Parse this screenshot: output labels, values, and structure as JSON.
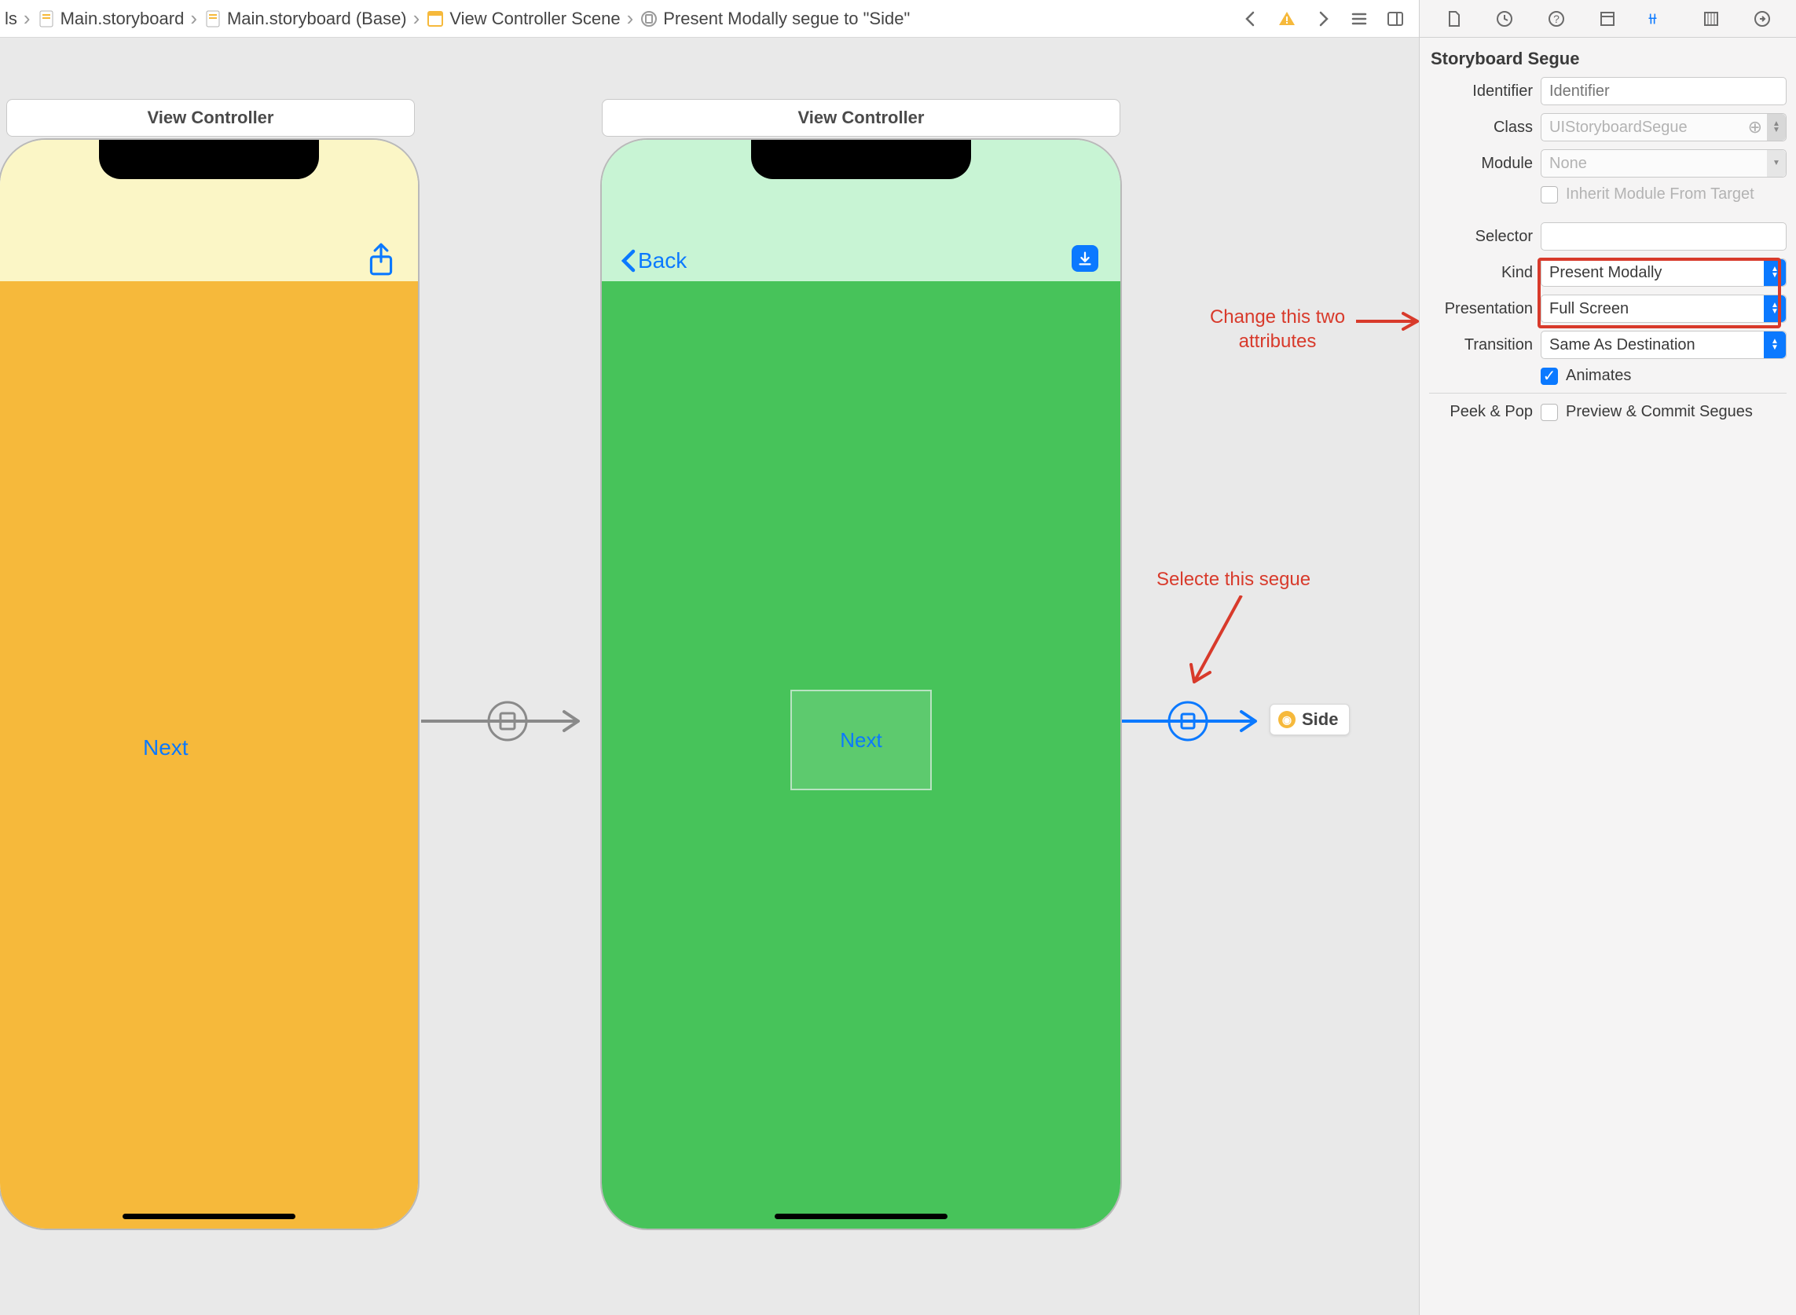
{
  "breadcrumb": {
    "item0": "ls",
    "item1": "Main.storyboard",
    "item2": "Main.storyboard (Base)",
    "item3": "View Controller Scene",
    "item4": "Present Modally segue to \"Side\""
  },
  "canvas": {
    "vc1_title": "View Controller",
    "vc2_title": "View Controller",
    "vc1_next": "Next",
    "vc2_next": "Next",
    "vc2_back": "Back",
    "side_label": "Side"
  },
  "annot": {
    "segue": "Selecte this segue",
    "attrs_l1": "Change this two",
    "attrs_l2": "attributes"
  },
  "inspector": {
    "section_title": "Storyboard Segue",
    "labels": {
      "identifier": "Identifier",
      "class": "Class",
      "module": "Module",
      "inherit": "Inherit Module From Target",
      "selector": "Selector",
      "kind": "Kind",
      "presentation": "Presentation",
      "transition": "Transition",
      "animates": "Animates",
      "peekpop": "Peek & Pop",
      "preview": "Preview & Commit Segues"
    },
    "values": {
      "identifier_ph": "Identifier",
      "class_ph": "UIStoryboardSegue",
      "module_ph": "None",
      "selector": "",
      "kind": "Present Modally",
      "presentation": "Full Screen",
      "transition": "Same As Destination"
    }
  }
}
